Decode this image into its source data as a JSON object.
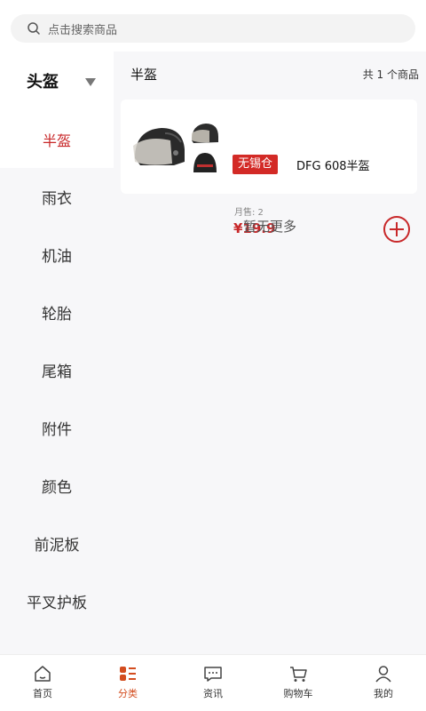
{
  "search": {
    "placeholder": "点击搜索商品",
    "icon": "search-icon"
  },
  "sidebar": {
    "header": "头盔",
    "items": [
      {
        "label": "半盔",
        "active": true
      },
      {
        "label": "雨衣"
      },
      {
        "label": "机油"
      },
      {
        "label": "轮胎"
      },
      {
        "label": "尾箱"
      },
      {
        "label": "附件"
      },
      {
        "label": "颜色"
      },
      {
        "label": "前泥板"
      },
      {
        "label": "平叉护板"
      }
    ]
  },
  "main": {
    "category_title": "半盔",
    "count_text": "共 1 个商品",
    "products": [
      {
        "store_tag": "无锡仓",
        "name": "DFG 608半盔",
        "monthly_sales": "月售: 2",
        "price": "¥19.9"
      }
    ],
    "no_more": "暂无更多"
  },
  "tabbar": {
    "tabs": [
      {
        "label": "首页",
        "icon": "home-icon"
      },
      {
        "label": "分类",
        "icon": "category-icon",
        "active": true
      },
      {
        "label": "资讯",
        "icon": "message-icon"
      },
      {
        "label": "购物车",
        "icon": "cart-icon"
      },
      {
        "label": "我的",
        "icon": "user-icon"
      }
    ]
  },
  "colors": {
    "accent": "#c8282a",
    "tag": "#d32a26",
    "tab_active": "#d34d1f"
  }
}
